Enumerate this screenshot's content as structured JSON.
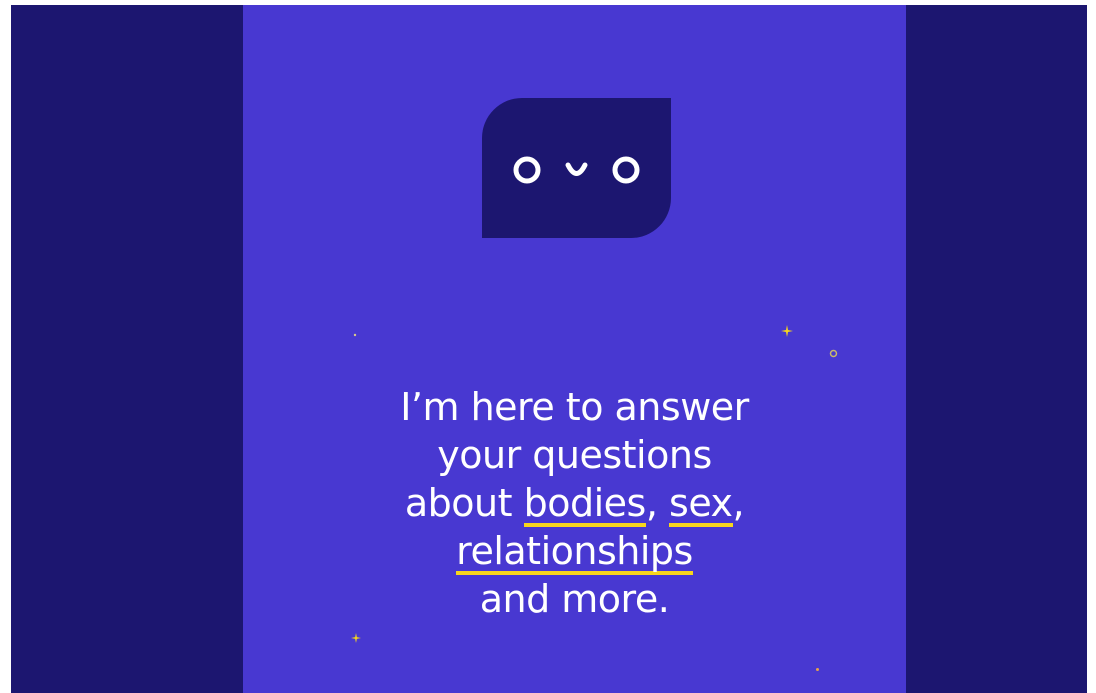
{
  "mascot": {
    "icon": "speech-bubble-face-icon",
    "bubble_color": "#1c1670",
    "face_color": "#ffffff"
  },
  "headline": {
    "line1": "I’m here to answer",
    "line2": "your questions",
    "line3_prefix": "about ",
    "topic1": "bodies",
    "comma1": ", ",
    "topic2": "sex",
    "comma2": ",",
    "topic3": "relationships",
    "line5": "and more."
  },
  "colors": {
    "frame_background": "#1c1670",
    "panel_background": "#4838d1",
    "text": "#ffffff",
    "highlight_underline": "#f7d51d"
  }
}
